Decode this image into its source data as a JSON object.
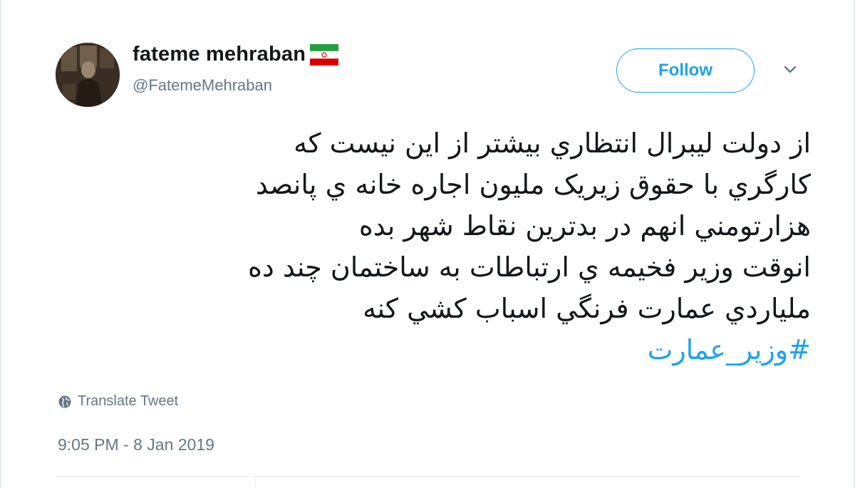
{
  "user": {
    "display_name": "fateme mehraban",
    "handle": "@FatemeMehraban",
    "flag_icon": "iran-flag-icon",
    "avatar_icon": "avatar-photo"
  },
  "actions": {
    "follow_label": "Follow",
    "menu_icon": "chevron-down-icon"
  },
  "tweet": {
    "lines": [
      "از دولت لیبرال انتظاري بیشتر از این نیست که",
      "کارگري با حقوق زیریک ملیون اجاره خانه ي پانصد",
      "هزارتومني انهم در بدترین نقاط شهر بده",
      "انوقت وزیر فخیمه ي ارتباطات به ساختمان چند ده",
      "ملیاردي عمارت فرنگي اسباب کشي کنه"
    ],
    "hashtag": "#وزیر_عمارت"
  },
  "footer": {
    "translate_label": "Translate Tweet",
    "translate_icon": "globe-icon",
    "timestamp": "9:05 PM - 8 Jan 2019"
  },
  "colors": {
    "accent": "#1da1f2",
    "secondary_text": "#657786",
    "primary_text": "#14171a",
    "border": "#e6ecf0"
  }
}
